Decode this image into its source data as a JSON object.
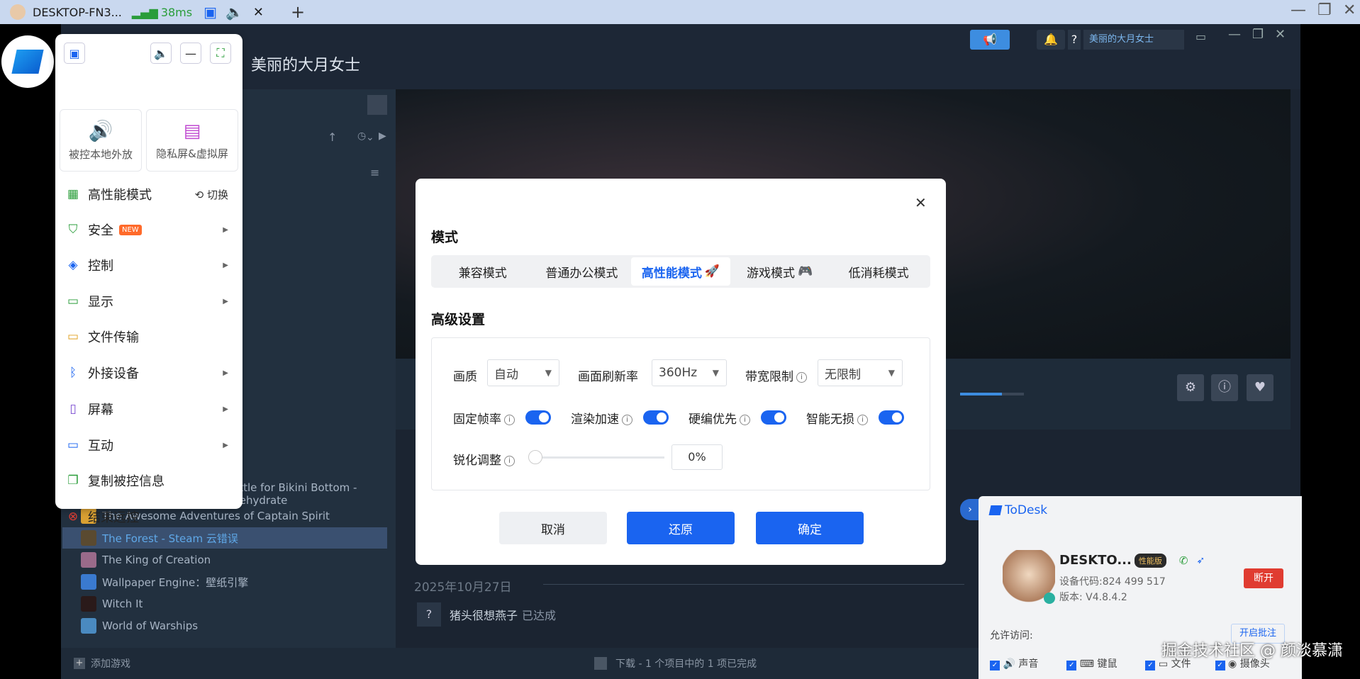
{
  "topbar": {
    "session_name": "DESKTOP-FN3...",
    "latency": "38ms",
    "add_tab": "+",
    "close_tab": "✕"
  },
  "steam": {
    "title": "美丽的大月女士",
    "user": "美丽的大月女士",
    "games": [
      "attle for Bikini Bottom - Rehydrate",
      "The Awesome Adventures of Captain Spirit",
      "The Forest - Steam 云错误",
      "The King of Creation",
      "Wallpaper Engine：壁纸引擎",
      "Witch It",
      "World of Warships"
    ],
    "date": "2025年10月27日",
    "activity_user": "猪头很想燕子",
    "activity_status": "已达成",
    "add_game": "添加游戏",
    "download_status": "下载 - 1 个项目中的 1 项已完成"
  },
  "quick_menu": {
    "speaker_btn": "被控本地外放",
    "privacy_btn": "隐私屏&虚拟屏",
    "items": [
      {
        "label": "高性能模式",
        "icon": "grid-icon"
      },
      {
        "label": "安全",
        "icon": "shield-icon"
      },
      {
        "label": "控制",
        "icon": "layers-icon"
      },
      {
        "label": "显示",
        "icon": "monitor-icon"
      },
      {
        "label": "文件传输",
        "icon": "folder-icon"
      },
      {
        "label": "外接设备",
        "icon": "bluetooth-icon"
      },
      {
        "label": "屏幕",
        "icon": "screen-icon"
      },
      {
        "label": "互动",
        "icon": "chat-icon"
      },
      {
        "label": "复制被控信息",
        "icon": "copy-icon"
      },
      {
        "label": "结束远控",
        "icon": "end-icon"
      }
    ],
    "switch_label": "切换",
    "new_badge": "NEW"
  },
  "dialog": {
    "mode_title": "模式",
    "tabs": [
      "兼容模式",
      "普通办公模式",
      "高性能模式",
      "游戏模式",
      "低消耗模式"
    ],
    "active_tab": 2,
    "advanced_title": "高级设置",
    "quality_label": "画质",
    "quality_value": "自动",
    "refresh_label": "画面刷新率",
    "refresh_value": "360Hz",
    "bandwidth_label": "带宽限制",
    "bandwidth_value": "无限制",
    "fixed_fps_label": "固定帧率",
    "render_label": "渲染加速",
    "hw_encode_label": "硬编优先",
    "lossless_label": "智能无损",
    "sharpen_label": "锐化调整",
    "sharpen_value": "0%",
    "sharpen_level": 0,
    "cancel": "取消",
    "restore": "还原",
    "confirm": "确定",
    "close": "✕"
  },
  "todesk": {
    "brand": "ToDesk",
    "device": "DESKTO...",
    "edition": "性能版",
    "code": "设备代码:824 499 517",
    "version": "版本: V4.8.4.2",
    "disconnect": "断开",
    "allow_access": "允许访问:",
    "enable_annotate": "开启批注",
    "perm_sound": "声音",
    "perm_keyboard": "键鼠",
    "perm_file": "文件",
    "perm_camera": "摄像头"
  },
  "watermark": "掘金技术社区 @ 颜淡慕潇",
  "colors": {
    "accent": "#1a64f0",
    "steam_bg": "#1b2431",
    "danger": "#e03c31"
  }
}
